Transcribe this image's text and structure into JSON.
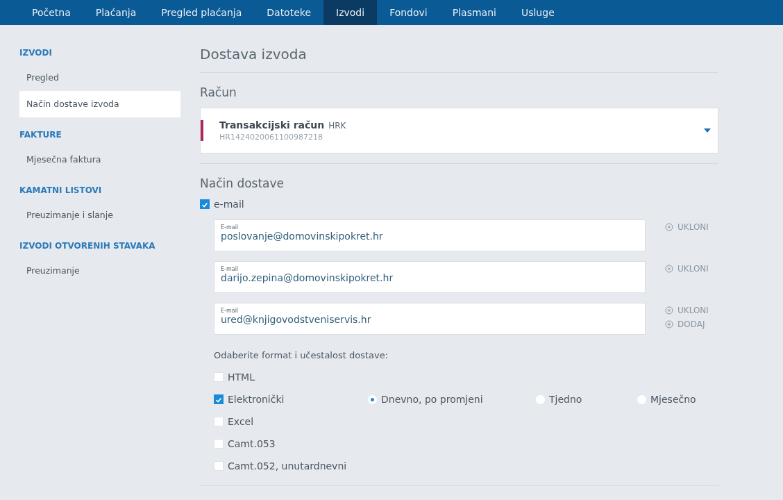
{
  "nav": [
    {
      "label": "Početna",
      "selected": false
    },
    {
      "label": "Plaćanja",
      "selected": false
    },
    {
      "label": "Pregled plaćanja",
      "selected": false
    },
    {
      "label": "Datoteke",
      "selected": false
    },
    {
      "label": "Izvodi",
      "selected": true
    },
    {
      "label": "Fondovi",
      "selected": false
    },
    {
      "label": "Plasmani",
      "selected": false
    },
    {
      "label": "Usluge",
      "selected": false
    }
  ],
  "sidebar": [
    {
      "heading": "IZVODI",
      "items": [
        {
          "label": "Pregled",
          "selected": false
        },
        {
          "label": "Način dostave izvoda",
          "selected": true
        }
      ]
    },
    {
      "heading": "FAKTURE",
      "items": [
        {
          "label": "Mjesečna faktura",
          "selected": false
        }
      ]
    },
    {
      "heading": "KAMATNI LISTOVI",
      "items": [
        {
          "label": "Preuzimanje i slanje",
          "selected": false
        }
      ]
    },
    {
      "heading": "IZVODI OTVORENIH STAVAKA",
      "items": [
        {
          "label": "Preuzimanje",
          "selected": false
        }
      ]
    }
  ],
  "page_title": "Dostava izvoda",
  "account_section": {
    "title": "Račun",
    "account": {
      "name": "Transakcijski račun",
      "currency": "HRK",
      "iban": "HR1424020061100987218"
    }
  },
  "delivery_section": {
    "title": "Način dostave",
    "email_option": {
      "label": "e-mail",
      "checked": true
    },
    "emails": [
      {
        "label": "E-mail",
        "value": "poslovanje@domovinskipokret.hr",
        "actions": [
          {
            "kind": "remove",
            "label": "UKLONI"
          }
        ]
      },
      {
        "label": "E-mail",
        "value": "darijo.zepina@domovinskipokret.hr",
        "actions": [
          {
            "kind": "remove",
            "label": "UKLONI"
          }
        ]
      },
      {
        "label": "E-mail",
        "value": "ured@knjigovodstveniservis.hr",
        "actions": [
          {
            "kind": "remove",
            "label": "UKLONI"
          },
          {
            "kind": "add",
            "label": "DODAJ"
          }
        ]
      }
    ],
    "format_prompt": "Odaberite format i učestalost dostave:",
    "formats": [
      {
        "label": "HTML",
        "checked": false
      },
      {
        "label": "Elektronički",
        "checked": true,
        "frequencies": [
          {
            "label": "Dnevno, po promjeni",
            "selected": true
          },
          {
            "label": "Tjedno",
            "selected": false
          },
          {
            "label": "Mjesečno",
            "selected": false
          }
        ]
      },
      {
        "label": "Excel",
        "checked": false
      },
      {
        "label": "Camt.053",
        "checked": false
      },
      {
        "label": "Camt.052, unutardnevni",
        "checked": false
      }
    ]
  }
}
